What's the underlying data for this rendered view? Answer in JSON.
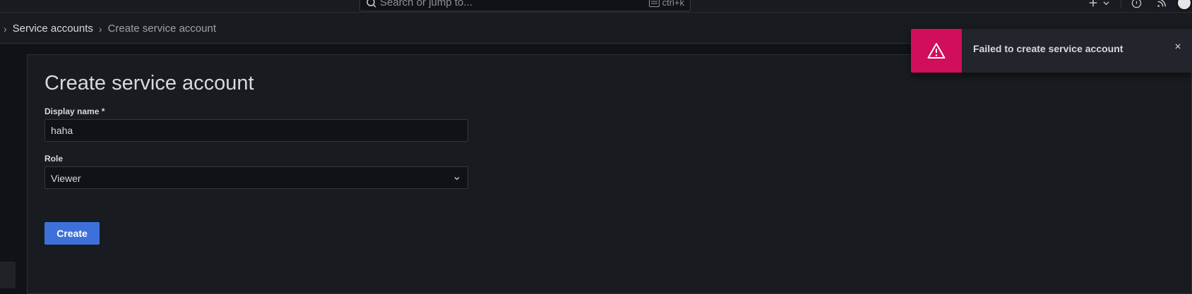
{
  "topbar": {
    "search_placeholder": "Search or jump to...",
    "shortcut": "ctrl+k",
    "icons": [
      "plus-icon",
      "chevron-down-icon",
      "help-icon",
      "rss-icon",
      "avatar"
    ]
  },
  "breadcrumb": {
    "items": [
      "Service accounts",
      "Create service account"
    ]
  },
  "page": {
    "title": "Create service account"
  },
  "form": {
    "display_name_label": "Display name *",
    "display_name_value": "haha",
    "role_label": "Role",
    "role_value": "Viewer",
    "submit_label": "Create"
  },
  "toast": {
    "message": "Failed to create service account",
    "close": "×",
    "accent_color": "#d10e5c"
  },
  "colors": {
    "primary_button": "#3d71d9",
    "background": "#111217",
    "panel": "#181b1f"
  }
}
